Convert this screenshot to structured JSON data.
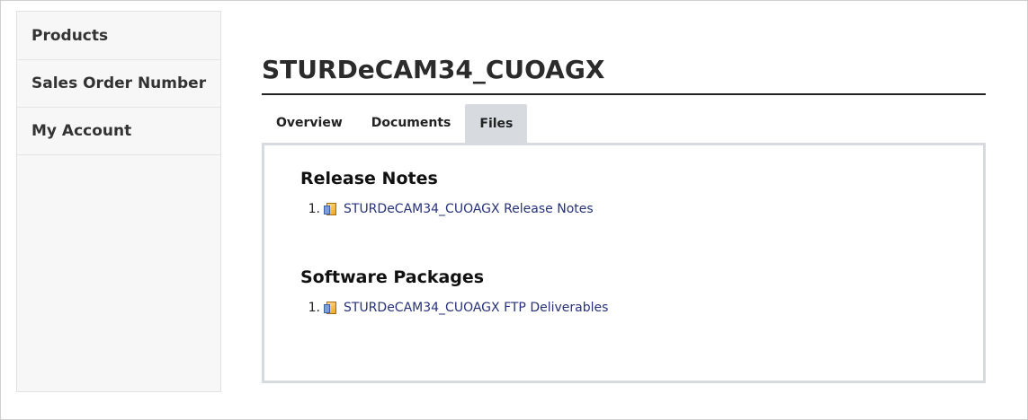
{
  "sidebar": {
    "items": [
      {
        "label": "Products"
      },
      {
        "label": "Sales Order Number"
      },
      {
        "label": "My Account"
      }
    ]
  },
  "page": {
    "title": "STURDeCAM34_CUOAGX"
  },
  "tabs": [
    {
      "label": "Overview",
      "active": false
    },
    {
      "label": "Documents",
      "active": false
    },
    {
      "label": "Files",
      "active": true
    }
  ],
  "sections": [
    {
      "title": "Release Notes",
      "files": [
        {
          "number": "1.",
          "icon": "document-icon",
          "label": "STURDeCAM34_CUOAGX Release Notes"
        }
      ]
    },
    {
      "title": "Software Packages",
      "files": [
        {
          "number": "1.",
          "icon": "document-icon",
          "label": "STURDeCAM34_CUOAGX FTP Deliverables"
        }
      ]
    }
  ],
  "colors": {
    "link": "#27327a",
    "active_tab": "#d7dbe0",
    "sidebar_bg": "#f7f7f7"
  }
}
